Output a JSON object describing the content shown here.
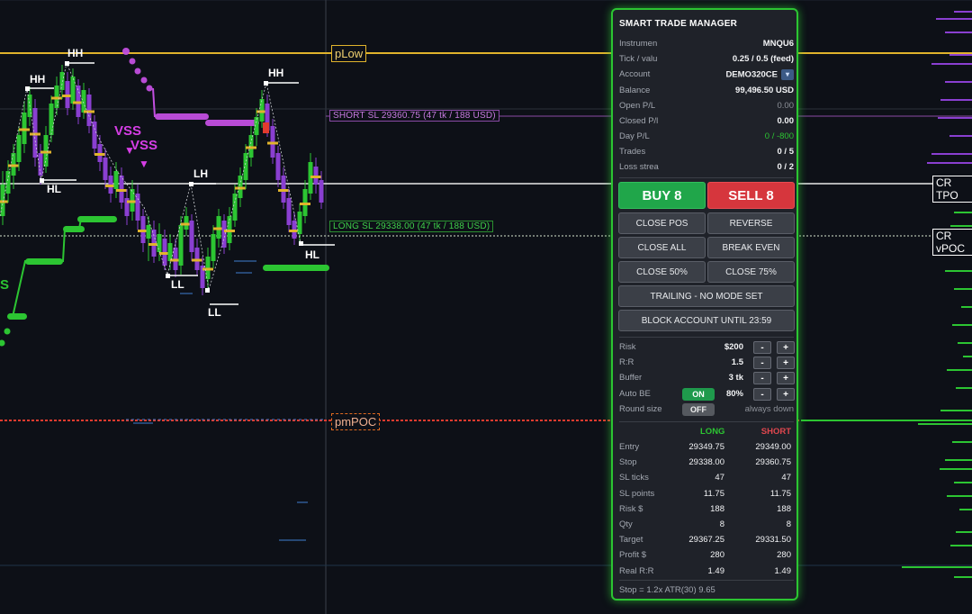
{
  "chart": {
    "swing_labels": {
      "hh1": "HH",
      "hh2": "HH",
      "hh3": "HH",
      "hl1": "HL",
      "hl2": "HL",
      "lh1": "LH",
      "ll1": "LL",
      "ll2": "LL"
    },
    "vss_labels": [
      "VSS",
      "VSS"
    ],
    "side_letter": "S",
    "plow_label": "pLow",
    "pmpoc_label": "pmPOC",
    "short_sl_label": "SHORT SL  29360.75  (47 tk / 188 USD)",
    "long_sl_label": "LONG SL  29338.00  (47 tk / 188 USD)",
    "cr_tpo_label": "CR TPO",
    "cr_vpoc_label": "CR vPOC",
    "colors": {
      "background": "#0d1017",
      "bull_candle": "#2cc532",
      "bear_candle": "#8a3fd1",
      "level_gold": "#e0b32c",
      "short_sl": "#b450d8",
      "long_sl": "#2cc532",
      "poc_red": "#e23b2f",
      "volume_profile": "#2cc532",
      "volume_profile_top": "#8a3fd1"
    }
  },
  "panel": {
    "title": "SMART TRADE MANAGER",
    "info": [
      {
        "label": "Instrumen",
        "value": "MNQU6"
      },
      {
        "label": "Tick / valu",
        "value": "0.25 / 0.5 (feed)"
      },
      {
        "label": "Account",
        "value": "DEMO320CE"
      },
      {
        "label": "Balance",
        "value": "99,496.50 USD"
      },
      {
        "label": "Open P/L",
        "value": "0.00"
      },
      {
        "label": "Closed P/l",
        "value": "0.00"
      },
      {
        "label": "Day P/L",
        "value": "0 / -800"
      },
      {
        "label": "Trades",
        "value": "0 / 5"
      },
      {
        "label": "Loss strea",
        "value": "0 / 2"
      }
    ],
    "buy_label": "BUY  8",
    "sell_label": "SELL  8",
    "buttons": {
      "close_pos": "CLOSE POS",
      "reverse": "REVERSE",
      "close_all": "CLOSE ALL",
      "break_even": "BREAK EVEN",
      "close_50": "CLOSE 50%",
      "close_75": "CLOSE 75%",
      "trailing": "TRAILING - NO MODE SET",
      "block": "BLOCK ACCOUNT UNTIL 23:59"
    },
    "settings": {
      "risk": {
        "label": "Risk",
        "value": "$200"
      },
      "rr": {
        "label": "R:R",
        "value": "1.5"
      },
      "buffer": {
        "label": "Buffer",
        "value": "3 tk"
      },
      "auto_be": {
        "label": "Auto BE",
        "toggle": "ON",
        "value": "80%"
      },
      "round_size": {
        "label": "Round size",
        "toggle": "OFF",
        "note": "always down"
      },
      "minus": "-",
      "plus": "+"
    },
    "table": {
      "long_header": "LONG",
      "short_header": "SHORT",
      "rows": [
        {
          "label": "Entry",
          "long": "29349.75",
          "short": "29349.00"
        },
        {
          "label": "Stop",
          "long": "29338.00",
          "short": "29360.75"
        },
        {
          "label": "SL ticks",
          "long": "47",
          "short": "47"
        },
        {
          "label": "SL points",
          "long": "11.75",
          "short": "11.75"
        },
        {
          "label": "Risk $",
          "long": "188",
          "short": "188"
        },
        {
          "label": "Qty",
          "long": "8",
          "short": "8"
        },
        {
          "label": "Target",
          "long": "29367.25",
          "short": "29331.50"
        },
        {
          "label": "Profit $",
          "long": "280",
          "short": "280"
        },
        {
          "label": "Real R:R",
          "long": "1.49",
          "short": "1.49"
        }
      ]
    },
    "footer": "Stop = 1.2x ATR(30) 9.65"
  }
}
